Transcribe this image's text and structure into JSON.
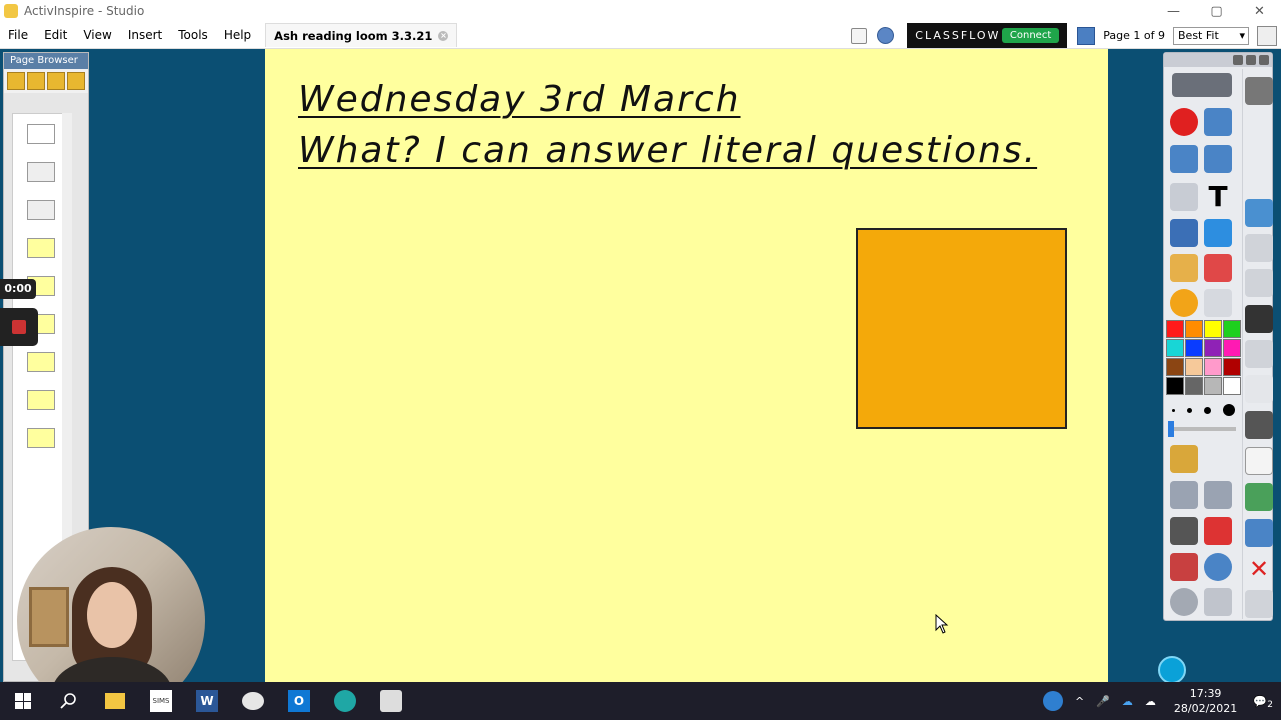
{
  "window": {
    "title": "ActivInspire - Studio",
    "controls": [
      "—",
      "▢",
      "✕"
    ]
  },
  "menu": [
    "File",
    "Edit",
    "View",
    "Insert",
    "Tools",
    "Help"
  ],
  "document_tab": {
    "label": "Ash reading loom 3.3.21"
  },
  "classflow": {
    "brand": "CLASSFLOW",
    "connect_label": "Connect"
  },
  "page_info": "Page 1 of 9",
  "zoom": {
    "value": "Best Fit"
  },
  "page_browser": {
    "title": "Page Browser"
  },
  "recording": {
    "timer": "0:00"
  },
  "flipchart": {
    "line1": "Wednesday 3rd March",
    "line2": "What? I can answer literal questions."
  },
  "colors": {
    "canvas_bg": "#ffff9e",
    "workspace_bg": "#0b4f73",
    "shape_fill": "#f4a90a",
    "palette": [
      "#ff1a1a",
      "#ff8c00",
      "#ffff00",
      "#1ed01e",
      "#18d6d6",
      "#0a3cff",
      "#8f22b6",
      "#ff1ab3",
      "#8b4513",
      "#f6c99a",
      "#ff9acb",
      "#b00000",
      "#000000",
      "#666666",
      "#b7b7b7",
      "#ffffff"
    ]
  },
  "taskbar": {
    "time": "17:39",
    "date": "28/02/2021",
    "notifications": "2",
    "apps": [
      "start-icon",
      "search-icon",
      "file-explorer-icon",
      "sims-icon",
      "word-icon",
      "paint-icon",
      "outlook-icon",
      "edge-icon",
      "activinspire-icon"
    ]
  }
}
